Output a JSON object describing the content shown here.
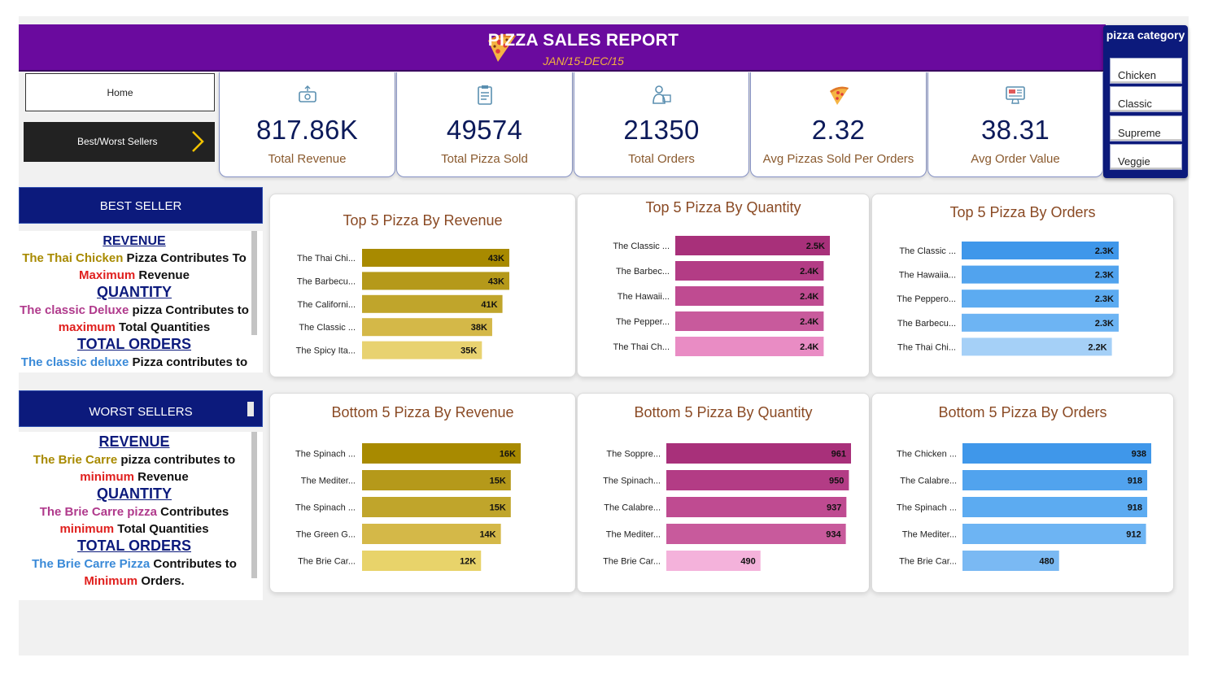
{
  "header": {
    "title": "PIZZA SALES REPORT",
    "subtitle": "JAN/15-DEC/15"
  },
  "slicer": {
    "title": "pizza category",
    "items": [
      "Chicken",
      "Classic",
      "Supreme",
      "Veggie"
    ]
  },
  "nav": {
    "home": "Home",
    "best_worst": "Best/Worst Sellers"
  },
  "kpis": [
    {
      "value": "817.86K",
      "label": "Total Revenue",
      "icon": "money-icon"
    },
    {
      "value": "49574",
      "label": "Total Pizza Sold",
      "icon": "clipboard-icon"
    },
    {
      "value": "21350",
      "label": "Total Orders",
      "icon": "delivery-icon"
    },
    {
      "value": "2.32",
      "label": "Avg Pizzas Sold Per Orders",
      "icon": "pizza-slice-icon"
    },
    {
      "value": "38.31",
      "label": "Avg Order Value",
      "icon": "monitor-icon"
    }
  ],
  "best": {
    "head": "BEST SELLER",
    "revenue_h": "REVENUE",
    "rev_name": "The Thai Chicken",
    "rev_t1": " Pizza Contributes To",
    "rev_max": "Maximum",
    "rev_t2": " Revenue",
    "qty_h": "QUANTITY",
    "qty_name": "The classic Deluxe",
    "qty_t1": " pizza Contributes to",
    "qty_max": "maximum",
    "qty_t2": " Total Quantities",
    "ord_h": "TOTAL ORDERS",
    "ord_name": "The classic deluxe",
    "ord_t1": " Pizza contributes to"
  },
  "worst": {
    "head": "WORST SELLERS",
    "revenue_h": "REVENUE",
    "rev_name": "The Brie Carre",
    "rev_t1": " pizza contributes to",
    "rev_min": "minimum",
    "rev_t2": " Revenue",
    "qty_h": "QUANTITY",
    "qty_name": "The Brie Carre pizza",
    "qty_t1": " Contributes",
    "qty_min": "minimum",
    "qty_t2": " Total Quantities",
    "ord_h": "TOTAL ORDERS",
    "ord_name": "The Brie Carre Pizza",
    "ord_t1": " Contributes to",
    "ord_min": "Minimum",
    "ord_t2": " Orders."
  },
  "colors": {
    "header": "#6a0a9e",
    "navy": "#0c1a7c",
    "gold": [
      "#a88a00",
      "#b5991a",
      "#c0a52b",
      "#d4b848",
      "#e8d270"
    ],
    "magenta": [
      "#a8307a",
      "#b33c85",
      "#bf4b91",
      "#c85a9c",
      "#e98cc4"
    ],
    "blue": [
      "#3f97ea",
      "#51a3ee",
      "#5cabf1",
      "#6db4f3",
      "#a5d0f7"
    ],
    "magenta_low": "#f4b2db",
    "blue_low": "#7ab9f3",
    "gold_low": "#e8d36a"
  },
  "chart_data": [
    {
      "type": "bar",
      "title": "Top 5 Pizza By Revenue",
      "categories": [
        "The Thai Chi...",
        "The Barbecu...",
        "The Californi...",
        "The Classic ...",
        "The Spicy Ita..."
      ],
      "values": [
        43,
        43,
        41,
        38,
        35
      ],
      "labels": [
        "43K",
        "43K",
        "41K",
        "38K",
        "35K"
      ],
      "palette": "gold"
    },
    {
      "type": "bar",
      "title": "Top 5 Pizza By Quantity",
      "categories": [
        "The Classic ...",
        "The Barbec...",
        "The Hawaii...",
        "The Pepper...",
        "The Thai Ch..."
      ],
      "values": [
        2.5,
        2.4,
        2.4,
        2.4,
        2.4
      ],
      "labels": [
        "2.5K",
        "2.4K",
        "2.4K",
        "2.4K",
        "2.4K"
      ],
      "palette": "magenta"
    },
    {
      "type": "bar",
      "title": "Top 5 Pizza By Orders",
      "categories": [
        "The Classic ...",
        "The Hawaiia...",
        "The Peppero...",
        "The Barbecu...",
        "The Thai Chi..."
      ],
      "values": [
        2.3,
        2.3,
        2.3,
        2.3,
        2.2
      ],
      "labels": [
        "2.3K",
        "2.3K",
        "2.3K",
        "2.3K",
        "2.2K"
      ],
      "palette": "blue"
    },
    {
      "type": "bar",
      "title": "Bottom 5 Pizza By Revenue",
      "categories": [
        "The Spinach ...",
        "The Mediter...",
        "The Spinach ...",
        "The Green G...",
        "The Brie Car..."
      ],
      "values": [
        16,
        15,
        15,
        14,
        12
      ],
      "labels": [
        "16K",
        "15K",
        "15K",
        "14K",
        "12K"
      ],
      "palette": "gold"
    },
    {
      "type": "bar",
      "title": "Bottom 5 Pizza By Quantity",
      "categories": [
        "The Soppre...",
        "The Spinach...",
        "The Calabre...",
        "The Mediter...",
        "The Brie Car..."
      ],
      "values": [
        961,
        950,
        937,
        934,
        490
      ],
      "labels": [
        "961",
        "950",
        "937",
        "934",
        "490"
      ],
      "palette": "magenta"
    },
    {
      "type": "bar",
      "title": "Bottom 5 Pizza By Orders",
      "categories": [
        "The Chicken ...",
        "The Calabre...",
        "The Spinach ...",
        "The Mediter...",
        "The Brie Car..."
      ],
      "values": [
        938,
        918,
        918,
        912,
        480
      ],
      "labels": [
        "938",
        "918",
        "918",
        "912",
        "480"
      ],
      "palette": "blue"
    }
  ]
}
